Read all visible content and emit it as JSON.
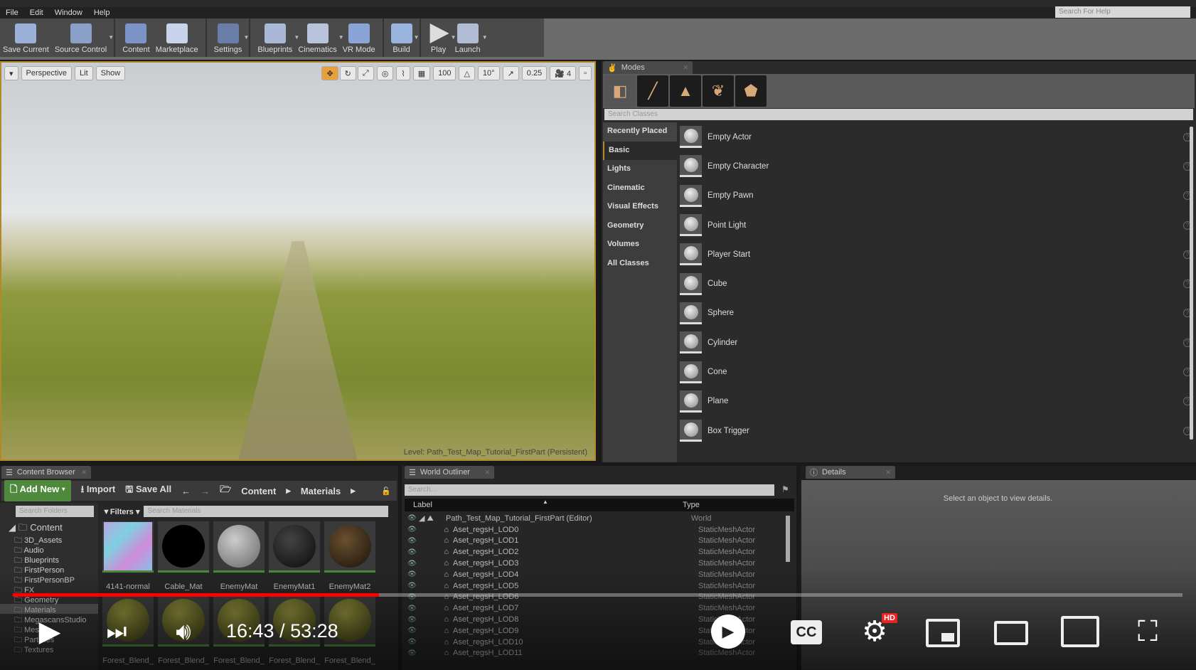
{
  "menu": [
    "File",
    "Edit",
    "Window",
    "Help"
  ],
  "help_search_placeholder": "Search For Help",
  "toolbar": [
    "Save Current",
    "Source Control",
    "Content",
    "Marketplace",
    "Settings",
    "Blueprints",
    "Cinematics",
    "VR Mode",
    "Build",
    "Play",
    "Launch"
  ],
  "viewport": {
    "view_mode": "Perspective",
    "lighting": "Lit",
    "show": "Show",
    "grid_snap": "100",
    "rotation_snap": "10°",
    "scale_snap": "0.25",
    "camera_speed": "4",
    "level": "Level:  Path_Test_Map_Tutorial_FirstPart (Persistent)"
  },
  "modes": {
    "tab": "Modes",
    "search_placeholder": "Search Classes",
    "categories": [
      "Recently Placed",
      "Basic",
      "Lights",
      "Cinematic",
      "Visual Effects",
      "Geometry",
      "Volumes",
      "All Classes"
    ],
    "selected_category": "Basic",
    "items": [
      "Empty Actor",
      "Empty Character",
      "Empty Pawn",
      "Point Light",
      "Player Start",
      "Cube",
      "Sphere",
      "Cylinder",
      "Cone",
      "Plane",
      "Box Trigger"
    ]
  },
  "content_browser": {
    "tab": "Content Browser",
    "add_new": "Add New",
    "import": "Import",
    "save_all": "Save All",
    "breadcrumb": [
      "Content",
      "Materials"
    ],
    "search_folders": "Search Folders",
    "filters": "Filters",
    "search_materials": "Search Materials",
    "root": "Content",
    "folders": [
      "3D_Assets",
      "Audio",
      "Blueprints",
      "FirstPerson",
      "FirstPersonBP",
      "FX",
      "Geometry",
      "Materials",
      "MegascansStudio",
      "Meshes",
      "Particles",
      "Textures"
    ],
    "selected_folder": "Materials",
    "assets": [
      "4141-normal",
      "Cable_Mat",
      "EnemyMat",
      "EnemyMat1",
      "EnemyMat2",
      "Forest_Blend_",
      "Forest_Blend_",
      "Forest_Blend_",
      "Forest_Blend_",
      "Forest_Blend_"
    ]
  },
  "world_outliner": {
    "tab": "World Outliner",
    "search_placeholder": "Search...",
    "col_label": "Label",
    "col_type": "Type",
    "rows": [
      {
        "label": "Path_Test_Map_Tutorial_FirstPart (Editor)",
        "type": "World"
      },
      {
        "label": "Aset_regsH_LOD0",
        "type": "StaticMeshActor"
      },
      {
        "label": "Aset_regsH_LOD1",
        "type": "StaticMeshActor"
      },
      {
        "label": "Aset_regsH_LOD2",
        "type": "StaticMeshActor"
      },
      {
        "label": "Aset_regsH_LOD3",
        "type": "StaticMeshActor"
      },
      {
        "label": "Aset_regsH_LOD4",
        "type": "StaticMeshActor"
      },
      {
        "label": "Aset_regsH_LOD5",
        "type": "StaticMeshActor"
      },
      {
        "label": "Aset_regsH_LOD6",
        "type": "StaticMeshActor"
      },
      {
        "label": "Aset_regsH_LOD7",
        "type": "StaticMeshActor"
      },
      {
        "label": "Aset_regsH_LOD8",
        "type": "StaticMeshActor"
      },
      {
        "label": "Aset_regsH_LOD9",
        "type": "StaticMeshActor"
      },
      {
        "label": "Aset_regsH_LOD10",
        "type": "StaticMeshActor"
      },
      {
        "label": "Aset_regsH_LOD11",
        "type": "StaticMeshActor"
      }
    ]
  },
  "details": {
    "tab": "Details",
    "message": "Select an object to view details."
  },
  "video": {
    "current": "16:43",
    "duration": "53:28",
    "time": "16:43 / 53:28",
    "progress": 0.313,
    "quality_badge": "HD",
    "cc": "CC",
    "accent": "#ff0000"
  }
}
